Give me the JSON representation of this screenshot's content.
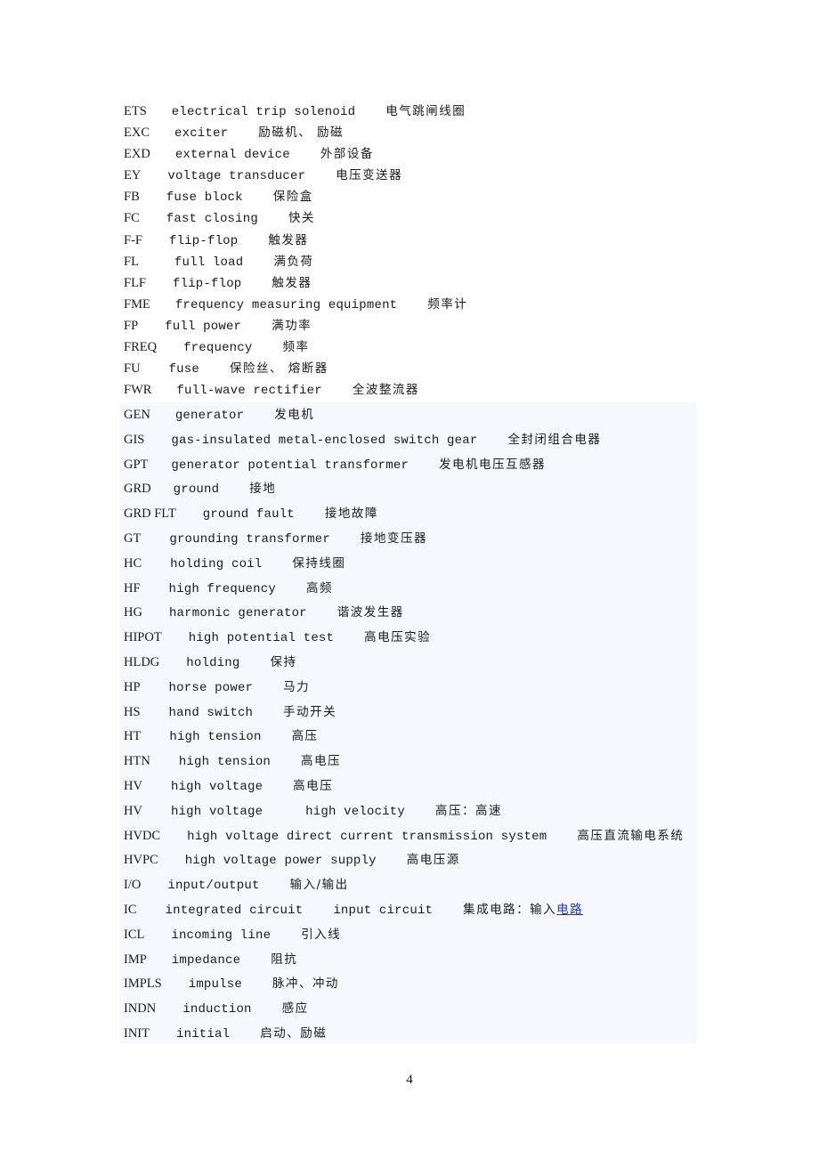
{
  "document": {
    "page_number": "4",
    "plain_entries": [
      {
        "abbr": "ETS",
        "english": "electrical trip solenoid",
        "chinese": "电气跳闸线圈"
      },
      {
        "abbr": "EXC",
        "english": "exciter",
        "chinese": "励磁机、 励磁"
      },
      {
        "abbr": "EXD",
        "english": "external device",
        "chinese": "外部设备"
      },
      {
        "abbr": "EY",
        "english": "voltage transducer",
        "chinese": "电压变送器"
      },
      {
        "abbr": "FB",
        "english": "fuse block",
        "chinese": "保险盒"
      },
      {
        "abbr": "FC",
        "english": "fast closing",
        "chinese": "快关"
      },
      {
        "abbr": "F-F",
        "english": "flip-flop",
        "chinese": "触发器"
      },
      {
        "abbr": "FL",
        "english": "full load",
        "chinese": "满负荷"
      },
      {
        "abbr": "FLF",
        "english": "flip-flop",
        "chinese": "触发器"
      },
      {
        "abbr": "FME",
        "english": "frequency measuring equipment",
        "chinese": "频率计"
      },
      {
        "abbr": "FP",
        "english": "full power",
        "chinese": "满功率"
      },
      {
        "abbr": "FREQ",
        "english": "frequency",
        "chinese": "频率"
      },
      {
        "abbr": "FU",
        "english": "fuse",
        "chinese": "保险丝、 熔断器"
      },
      {
        "abbr": "FWR",
        "english": "full-wave rectifier",
        "chinese": "全波整流器"
      }
    ],
    "shaded_entries": [
      {
        "abbr": "GEN",
        "english": "generator",
        "chinese": "发电机"
      },
      {
        "abbr": "GIS",
        "english": "gas-insulated metal-enclosed switch gear",
        "chinese": "全封闭组合电器"
      },
      {
        "abbr": "GPT",
        "english": "generator potential transformer",
        "chinese": "发电机电压互感器"
      },
      {
        "abbr": "GRD",
        "english": "ground",
        "chinese": "接地"
      },
      {
        "abbr": "GRD FLT",
        "english": "ground fault",
        "chinese": "接地故障"
      },
      {
        "abbr": "GT",
        "english": "grounding transformer",
        "chinese": "接地变压器"
      },
      {
        "abbr": "HC",
        "english": "holding coil",
        "chinese": "保持线圈"
      },
      {
        "abbr": "HF",
        "english": "high frequency",
        "chinese": "高频"
      },
      {
        "abbr": "HG",
        "english": "harmonic generator",
        "chinese": "谐波发生器"
      },
      {
        "abbr": "HIPOT",
        "english": "high potential test",
        "chinese": "高电压实验"
      },
      {
        "abbr": "HLDG",
        "english": "holding",
        "chinese": "保持"
      },
      {
        "abbr": "HP",
        "english": "horse power",
        "chinese": "马力"
      },
      {
        "abbr": "HS",
        "english": "hand switch",
        "chinese": "手动开关"
      },
      {
        "abbr": "HT",
        "english": "high tension",
        "chinese": "高压"
      },
      {
        "abbr": "HTN",
        "english": "high tension",
        "chinese": "高电压"
      },
      {
        "abbr": "HV",
        "english": "high voltage",
        "chinese": "高电压"
      },
      {
        "abbr": "HV",
        "english": "high voltage",
        "english2": "high velocity",
        "chinese": "高压：高速"
      },
      {
        "abbr": "HVDC",
        "english": "high voltage direct current transmission system",
        "chinese": "高压直流输电系统"
      },
      {
        "abbr": "HVPC",
        "english": "high voltage power supply",
        "chinese": "高电压源"
      },
      {
        "abbr": "I/O",
        "english": "input/output",
        "chinese": "输入/输出"
      },
      {
        "abbr": "IC",
        "english": "integrated circuit",
        "english2": "input circuit",
        "chinese": "集成电路：输入",
        "chinese_link": "电路"
      },
      {
        "abbr": "ICL",
        "english": "incoming line",
        "chinese": "引入线"
      },
      {
        "abbr": "IMP",
        "english": "impedance",
        "chinese": "阻抗"
      },
      {
        "abbr": "IMPLS",
        "english": "impulse",
        "chinese": "脉冲、冲动"
      },
      {
        "abbr": "INDN",
        "english": "induction",
        "chinese": "感应"
      },
      {
        "abbr": "INIT",
        "english": "initial",
        "chinese": "启动、励磁"
      }
    ]
  }
}
